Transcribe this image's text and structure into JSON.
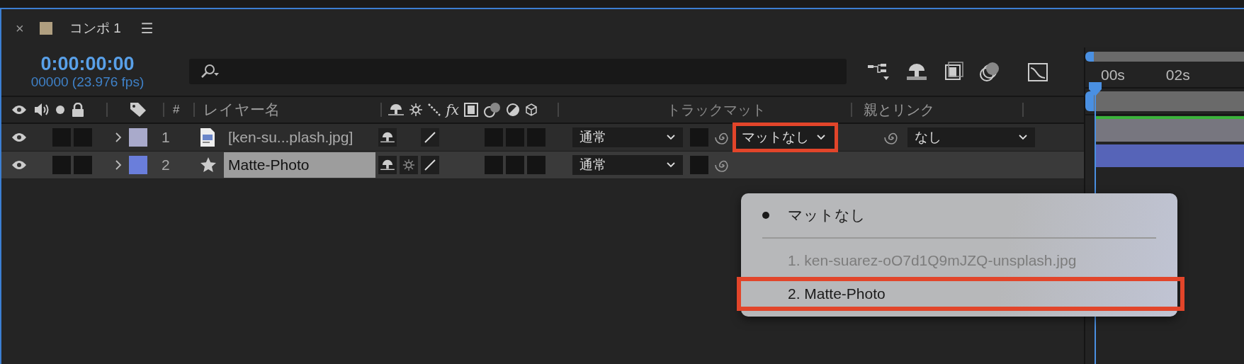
{
  "tab": {
    "close": "×",
    "title": "コンポ 1",
    "menu": "☰"
  },
  "time": {
    "timecode": "0:00:00:00",
    "frames": "00000 (23.976 fps)"
  },
  "columns": {
    "number": "#",
    "effects": "fx",
    "layer_name": "レイヤー名",
    "track_matte": "トラックマット",
    "parent": "親とリンク"
  },
  "layers": [
    {
      "number": "1",
      "name": "[ken-su...plash.jpg]",
      "kind": "footage",
      "color": "#a9aacb",
      "selected": false,
      "mode": "通常",
      "matte": "マットなし",
      "matte_highlighted": true,
      "parent": "なし"
    },
    {
      "number": "2",
      "name": "Matte-Photo",
      "kind": "shape",
      "color": "#6a7edb",
      "selected": true,
      "mode": "通常"
    }
  ],
  "timeline": {
    "ticks": [
      "00s",
      "02s"
    ]
  },
  "menu": {
    "items": [
      {
        "kind": "option",
        "label": "マットなし",
        "checked": true,
        "disabled": false,
        "highlighted": false
      },
      {
        "kind": "separator"
      },
      {
        "kind": "option",
        "label": "1. ken-suarez-oO7d1Q9mJZQ-unsplash.jpg",
        "checked": false,
        "disabled": true,
        "highlighted": false
      },
      {
        "kind": "option",
        "label": "2. Matte-Photo",
        "checked": false,
        "disabled": false,
        "highlighted": true
      }
    ]
  }
}
